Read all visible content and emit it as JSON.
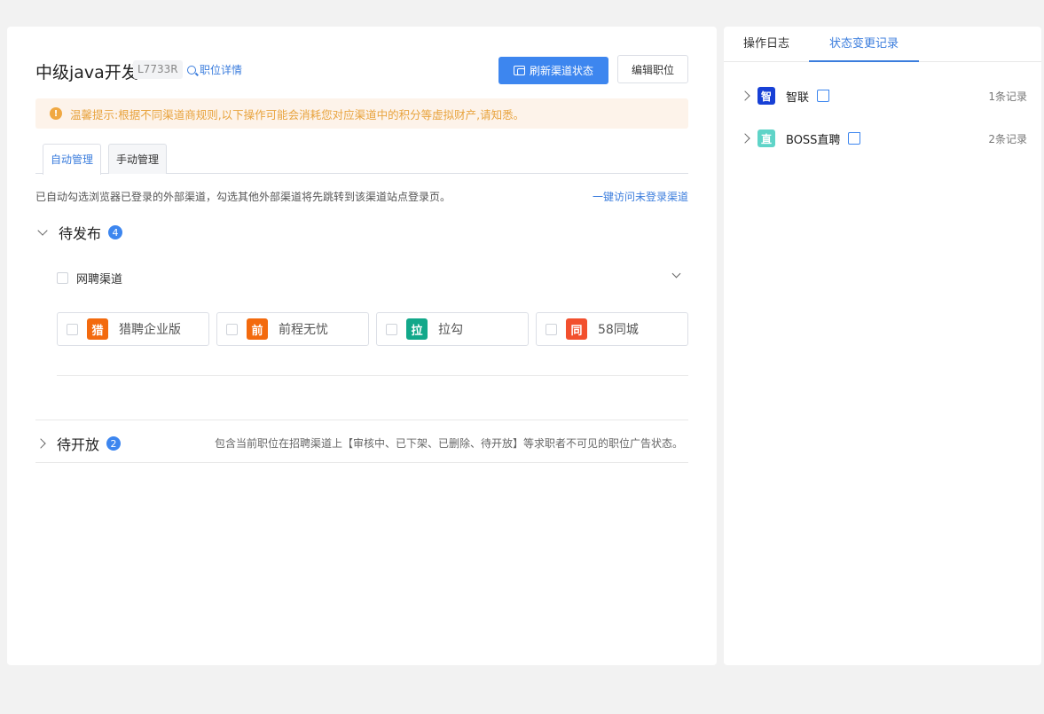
{
  "header": {
    "job_title": "中级java开发",
    "job_code": "L7733R",
    "job_detail_link": "职位详情",
    "refresh_button": "刷新渠道状态",
    "edit_button": "编辑职位"
  },
  "alert": {
    "text": "温馨提示:根据不同渠道商规则,以下操作可能会消耗您对应渠道中的积分等虚拟财产,请知悉。"
  },
  "tabs": [
    {
      "label": "自动管理",
      "active": true
    },
    {
      "label": "手动管理",
      "active": false
    }
  ],
  "hint": {
    "text": "已自动勾选浏览器已登录的外部渠道，勾选其他外部渠道将先跳转到该渠道站点登录页。",
    "link": "一键访问未登录渠道"
  },
  "pending_publish": {
    "title": "待发布",
    "count": "4",
    "group_label": "网聘渠道",
    "channels": [
      {
        "logo": "猎",
        "name": "猎聘企业版",
        "color": "#f36a0e"
      },
      {
        "logo": "前",
        "name": "前程无忧",
        "color": "#f36a0e"
      },
      {
        "logo": "拉",
        "name": "拉勾",
        "color": "#12a88a"
      },
      {
        "logo": "同",
        "name": "58同城",
        "color": "#f2502e"
      }
    ]
  },
  "pending_open": {
    "title": "待开放",
    "count": "2",
    "note": "包含当前职位在招聘渠道上【审核中、已下架、已删除、待开放】等求职者不可见的职位广告状态。"
  },
  "right_panel": {
    "tabs": [
      {
        "label": "操作日志",
        "active": false
      },
      {
        "label": "状态变更记录",
        "active": true
      }
    ],
    "records": [
      {
        "logo": "智",
        "name": "智联",
        "count": "1条记录",
        "color": "#1740d6"
      },
      {
        "logo": "直",
        "name": "BOSS直聘",
        "count": "2条记录",
        "color": "#5fd4c8"
      }
    ]
  }
}
